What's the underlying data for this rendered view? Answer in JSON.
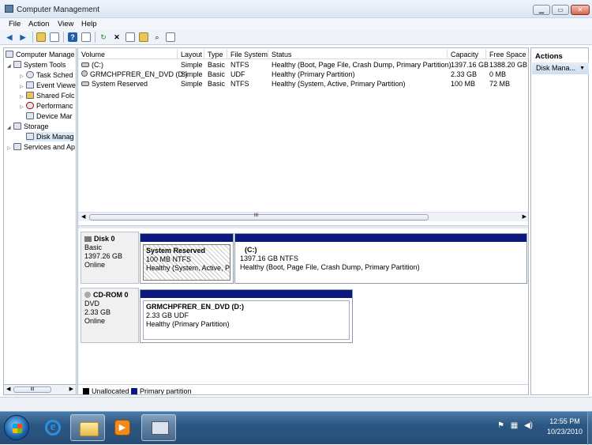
{
  "window": {
    "title": "Computer Management",
    "controls": [
      "minimize",
      "maximize",
      "close"
    ]
  },
  "menu": [
    "File",
    "Action",
    "View",
    "Help"
  ],
  "toolbar": {
    "icons": [
      "back-icon",
      "forward-icon",
      "up-folder-icon",
      "show-hide-tree-icon",
      "help-icon",
      "view-icon",
      "refresh-icon",
      "delete-icon",
      "properties-icon",
      "open-icon",
      "search-icon",
      "export-icon"
    ]
  },
  "tree": {
    "root": "Computer Manage",
    "system_tools": "System Tools",
    "task_sched": "Task Sched",
    "event_viewer": "Event Viewe",
    "shared_folders": "Shared Folc",
    "performance": "Performanc",
    "device_mgr": "Device Mar",
    "storage": "Storage",
    "disk_mgmt": "Disk Manag",
    "services": "Services and Ap"
  },
  "volumes": {
    "columns": [
      "Volume",
      "Layout",
      "Type",
      "File System",
      "Status",
      "Capacity",
      "Free Space"
    ],
    "rows": [
      {
        "volume": "(C:)",
        "layout": "Simple",
        "type": "Basic",
        "fs": "NTFS",
        "status": "Healthy (Boot, Page File, Crash Dump, Primary Partition)",
        "capacity": "1397.16 GB",
        "free": "1388.20 GB"
      },
      {
        "volume": "GRMCHPFRER_EN_DVD (D:)",
        "layout": "Simple",
        "type": "Basic",
        "fs": "UDF",
        "status": "Healthy (Primary Partition)",
        "capacity": "2.33 GB",
        "free": "0 MB"
      },
      {
        "volume": "System Reserved",
        "layout": "Simple",
        "type": "Basic",
        "fs": "NTFS",
        "status": "Healthy (System, Active, Primary Partition)",
        "capacity": "100 MB",
        "free": "72 MB"
      }
    ]
  },
  "scroll_thumb_label": "III",
  "disks": {
    "disk0": {
      "name": "Disk 0",
      "type": "Basic",
      "size": "1397.26 GB",
      "state": "Online",
      "p1": {
        "name": "System Reserved",
        "size": "100 MB NTFS",
        "status": "Healthy (System, Active, Prir"
      },
      "p2": {
        "name": "(C:)",
        "size": "1397.16 GB NTFS",
        "status": "Healthy (Boot, Page File, Crash Dump, Primary Partition)"
      }
    },
    "cdrom0": {
      "name": "CD-ROM 0",
      "type": "DVD",
      "size": "2.33 GB",
      "state": "Online",
      "p1": {
        "name": "GRMCHPFRER_EN_DVD  (D:)",
        "size": "2.33 GB UDF",
        "status": "Healthy (Primary Partition)"
      }
    }
  },
  "legend": {
    "unallocated": "Unallocated",
    "primary": "Primary partition",
    "colors": {
      "unallocated": "#000000",
      "primary": "#0a1a80"
    }
  },
  "actions": {
    "title": "Actions",
    "item": "Disk Mana..."
  },
  "taskbar": {
    "time": "12:55 PM",
    "date": "10/23/2010"
  }
}
